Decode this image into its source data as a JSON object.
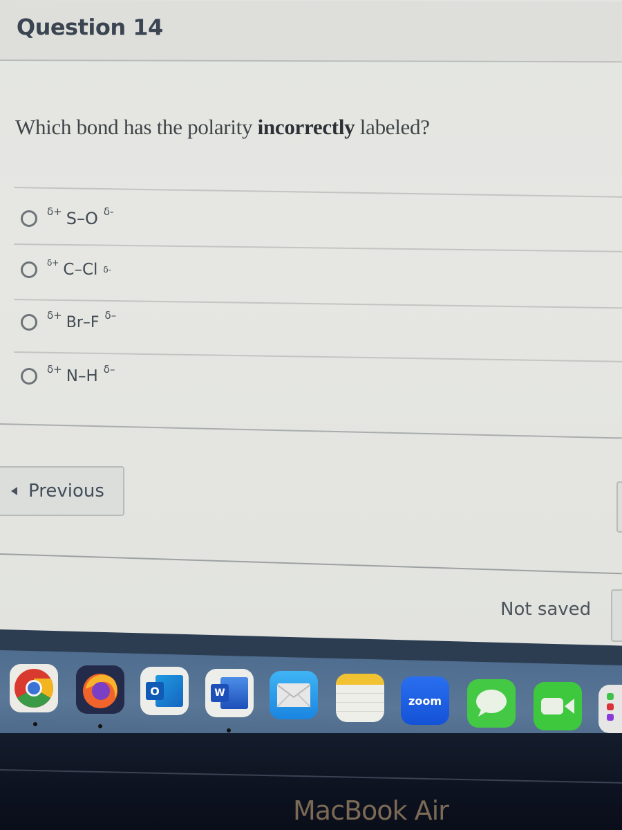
{
  "quiz": {
    "question_title": "Question 14",
    "prompt_before": "Which bond has the polarity ",
    "prompt_emphasis": "incorrectly",
    "prompt_after": " labeled?",
    "answers": [
      {
        "partial_positive": "δ+",
        "bond": "S–O",
        "partial_negative": "δ-",
        "selected": false
      },
      {
        "partial_positive": "δ+",
        "bond": "C–Cl",
        "partial_negative": "δ-",
        "selected": false
      },
      {
        "partial_positive": "δ+",
        "bond": "Br–F",
        "partial_negative": "δ–",
        "selected": false
      },
      {
        "partial_positive": "δ+",
        "bond": "N–H",
        "partial_negative": "δ–",
        "selected": false
      }
    ]
  },
  "navigation": {
    "previous_label": "Previous",
    "previous_icon": "triangle-left-icon"
  },
  "footer": {
    "save_status": "Not saved"
  },
  "dock": {
    "apps": [
      {
        "name": "Google Chrome",
        "icon": "chrome-icon",
        "running": true
      },
      {
        "name": "Firefox",
        "icon": "firefox-icon",
        "running": true
      },
      {
        "name": "Microsoft Outlook",
        "icon": "outlook-icon",
        "label": "O",
        "running": false
      },
      {
        "name": "Microsoft Word",
        "icon": "word-icon",
        "label": "W",
        "running": true
      },
      {
        "name": "Mail",
        "icon": "mail-icon",
        "running": false
      },
      {
        "name": "Notes",
        "icon": "notes-icon",
        "running": false
      },
      {
        "name": "Zoom",
        "icon": "zoom-icon",
        "label": "zoom",
        "running": false
      },
      {
        "name": "Messages",
        "icon": "messages-icon",
        "running": false
      },
      {
        "name": "FaceTime",
        "icon": "facetime-icon",
        "running": false
      },
      {
        "name": "Reminders",
        "icon": "reminders-icon",
        "running": false
      }
    ]
  },
  "device": {
    "brand_label": "MacBook Air"
  },
  "colors": {
    "page_background": "#e3e4e0",
    "heading_text": "#3b4552",
    "body_text": "#3f4448",
    "dock_background": "#5a7797",
    "zoom_blue": "#1f5fe0",
    "facetime_green": "#3ec83e"
  }
}
